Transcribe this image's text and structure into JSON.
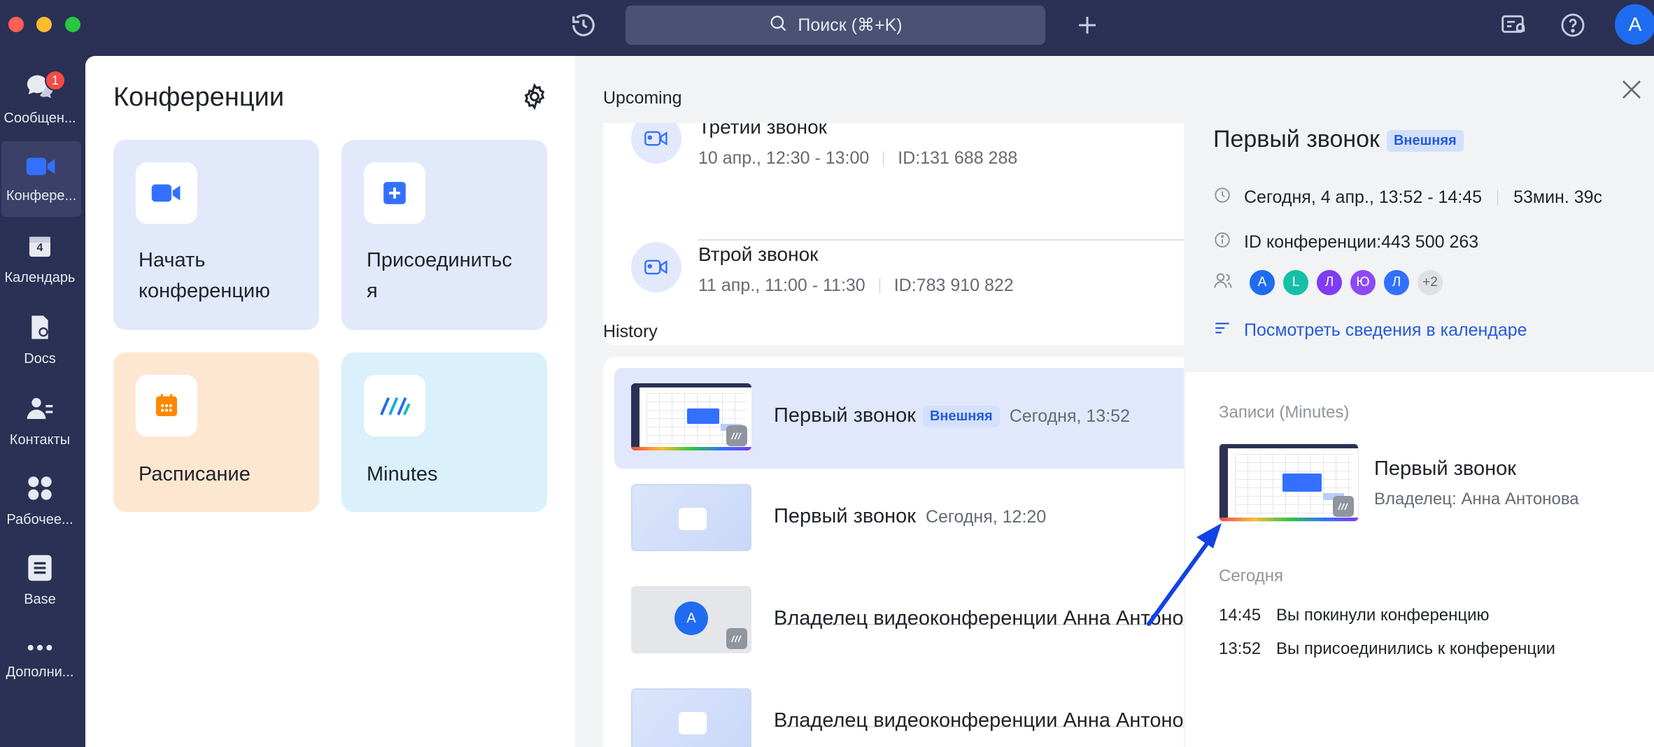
{
  "topbar": {
    "search_label": "Поиск (⌘+K)",
    "avatar_initial": "A",
    "icons": [
      "history-icon",
      "search-icon",
      "plus-icon",
      "notifications-icon",
      "help-icon"
    ]
  },
  "rail": {
    "items": [
      {
        "label": "Сообщен...",
        "icon": "chat-icon",
        "badge": "1"
      },
      {
        "label": "Конфере...",
        "icon": "video-icon",
        "active": true
      },
      {
        "label": "Календарь",
        "icon": "calendar-icon",
        "day": "4"
      },
      {
        "label": "Docs",
        "icon": "docs-icon"
      },
      {
        "label": "Контакты",
        "icon": "contacts-icon"
      },
      {
        "label": "Рабочее...",
        "icon": "workplace-icon"
      },
      {
        "label": "Base",
        "icon": "base-icon"
      },
      {
        "label": "Дополни...",
        "icon": "more-icon"
      }
    ]
  },
  "meetings": {
    "title": "Конференции",
    "tiles": [
      {
        "label_line1": "Начать",
        "label_line2": "конференцию",
        "color": "#e1e9fb"
      },
      {
        "label_line1": "Присоединитьс",
        "label_line2": "я",
        "color": "#e1e9fb"
      },
      {
        "label": "Расписание",
        "color": "#fee7d1"
      },
      {
        "label": "Minutes",
        "color": "#daf0fa"
      }
    ]
  },
  "upcoming": {
    "title": "Upcoming",
    "items": [
      {
        "title": "Третий звонок",
        "time": "10 апр., 12:30 - 13:00",
        "id": "ID:131 688 288"
      },
      {
        "title": "Втрой звонок",
        "time": "11 апр., 11:00 - 11:30",
        "id": "ID:783 910 822"
      }
    ]
  },
  "history": {
    "title": "History",
    "items": [
      {
        "title": "Первый звонок",
        "tag": "Внешняя",
        "time": "Сегодня, 13:52"
      },
      {
        "title": "Первый звонок",
        "time": "Сегодня, 12:20"
      },
      {
        "title": "Владелец видеоконференции Анна Антонова",
        "avatar": "A"
      },
      {
        "title": "Владелец видеоконференции Анна Антонова"
      }
    ]
  },
  "detail": {
    "title": "Первый звонок",
    "tag": "Внешняя",
    "datetime": "Сегодня, 4 апр., 13:52 - 14:45",
    "duration": "53мин. 39с",
    "conference_id": "ID конференции:443 500 263",
    "participants": [
      {
        "initial": "A",
        "color": "#1f6cf0"
      },
      {
        "initial": "L",
        "color": "#14c0a8"
      },
      {
        "initial": "Л",
        "color": "#7f3bf5"
      },
      {
        "initial": "Ю",
        "color": "#8c4af7"
      },
      {
        "initial": "Л",
        "color": "#3370ff"
      }
    ],
    "more_participants": "+2",
    "calendar_link": "Посмотреть сведения в календаре",
    "records_title": "Записи (Minutes)",
    "record": {
      "title": "Первый звонок",
      "owner": "Владелец: Анна Антонова"
    },
    "events_title": "Сегодня",
    "events": [
      {
        "time": "14:45",
        "text": "Вы покинули конференцию"
      },
      {
        "time": "13:52",
        "text": "Вы присоединились к конференции"
      }
    ]
  },
  "colors": {
    "accent": "#245bdb",
    "arrow": "#1342e6",
    "rail_bg": "#2b3154"
  }
}
